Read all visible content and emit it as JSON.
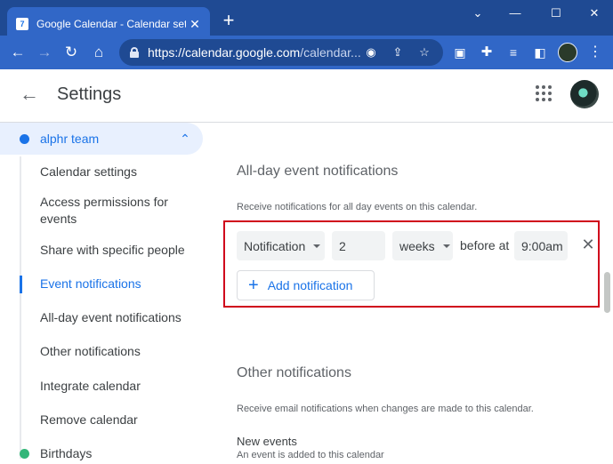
{
  "browser": {
    "tab_title": "Google Calendar - Calendar settings",
    "tab_favicon": "7",
    "url_host": "https://calendar.google.com",
    "url_rest": "/calendar..."
  },
  "header": {
    "title": "Settings"
  },
  "sidebar": {
    "calendar_name": "alphr team",
    "calendar_color": "#1a73e8",
    "items": [
      {
        "label": "Calendar settings"
      },
      {
        "label": "Access permissions for events"
      },
      {
        "label": "Share with specific people"
      },
      {
        "label": "Event notifications"
      },
      {
        "label": "All-day event notifications"
      },
      {
        "label": "Other notifications"
      },
      {
        "label": "Integrate calendar"
      },
      {
        "label": "Remove calendar"
      }
    ],
    "active_item": "Event notifications",
    "other_calendar": "Birthdays",
    "other_calendar_color": "#33b679"
  },
  "main": {
    "allday": {
      "title": "All-day event notifications",
      "description": "Receive notifications for all day events on this calendar.",
      "notification": {
        "type": "Notification",
        "amount": "2",
        "unit": "weeks",
        "before_label": "before at",
        "time": "9:00am"
      },
      "add_label": "Add notification"
    },
    "other": {
      "title": "Other notifications",
      "description": "Receive email notifications when changes are made to this calendar.",
      "new_events_title": "New events",
      "new_events_desc": "An event is added to this calendar"
    }
  }
}
